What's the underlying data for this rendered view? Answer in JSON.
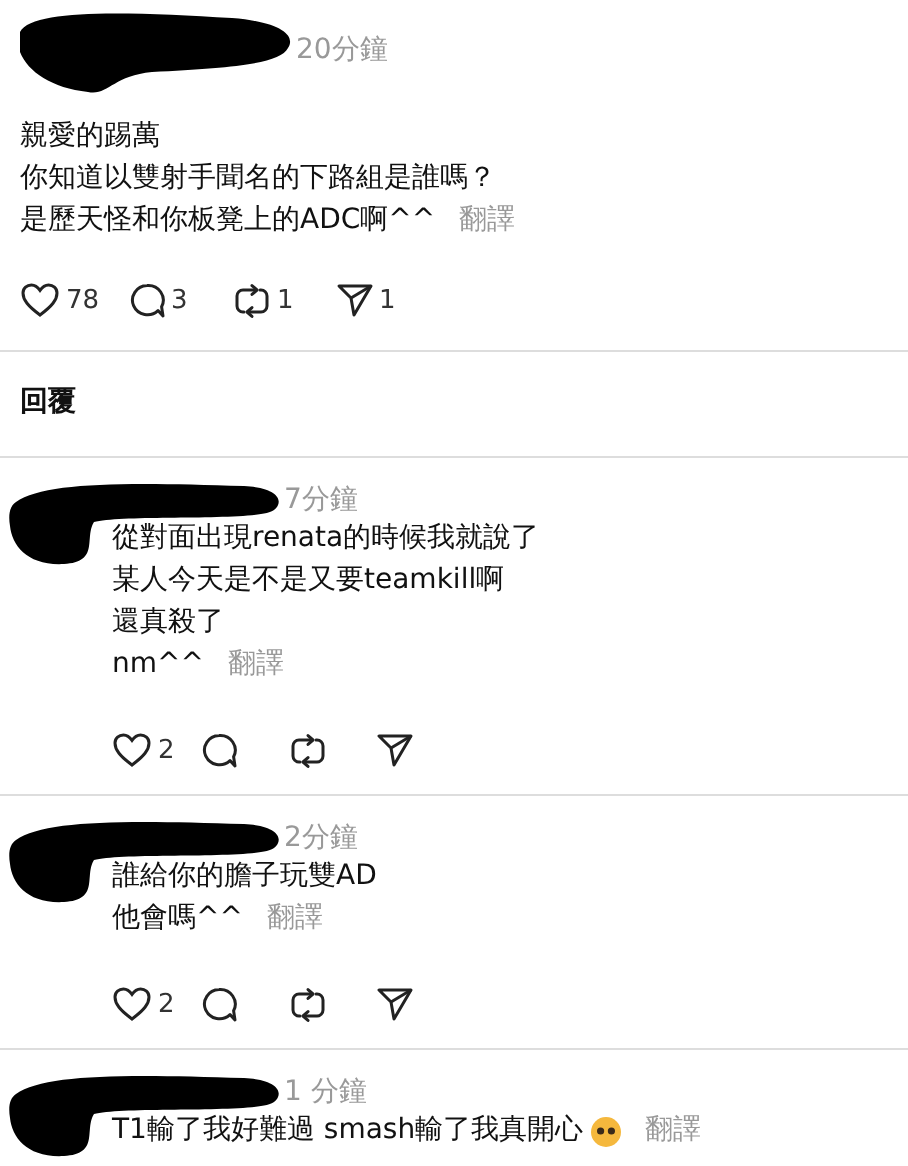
{
  "post": {
    "time": "20分鐘",
    "lines": [
      "親愛的踢萬",
      "你知道以雙射手聞名的下路組是誰嗎？",
      "是歷天怪和你板凳上的ADC啊^^"
    ],
    "translate": "翻譯",
    "actions": {
      "likes": "78",
      "comments": "3",
      "reposts": "1",
      "shares": "1"
    }
  },
  "replies_heading": "回覆",
  "replies": [
    {
      "time": "7分鐘",
      "lines": [
        "從對面出現renata的時候我就說了",
        "某人今天是不是又要teamkill啊",
        "還真殺了",
        "nm^^"
      ],
      "translate": "翻譯",
      "emoji": false,
      "actions": {
        "likes": "2"
      }
    },
    {
      "time": "2分鐘",
      "lines": [
        "誰給你的膽子玩雙AD",
        "他會嗎^^"
      ],
      "translate": "翻譯",
      "emoji": false,
      "actions": {
        "likes": "2"
      }
    },
    {
      "time": "1 分鐘",
      "lines": [
        "T1輸了我好難過 smash輸了我真開心"
      ],
      "translate": "翻譯",
      "emoji": true
    }
  ]
}
